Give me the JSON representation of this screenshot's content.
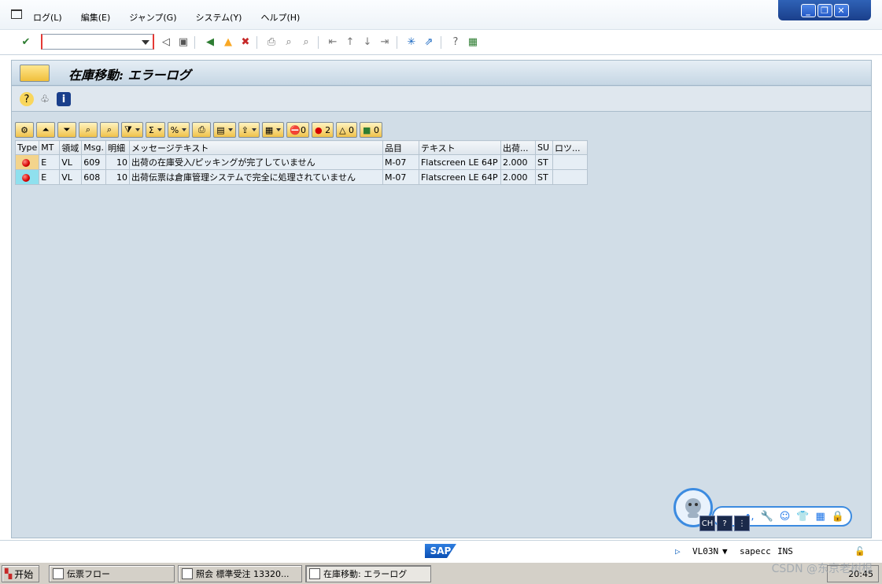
{
  "menubar": {
    "items": [
      "ログ(L)",
      "編集(E)",
      "ジャンプ(G)",
      "システム(Y)",
      "ヘルプ(H)"
    ]
  },
  "window_controls": [
    "minimize",
    "restore",
    "close"
  ],
  "command_field": {
    "value": ""
  },
  "screen": {
    "title": "在庫移動: エラーログ"
  },
  "grid": {
    "columns": [
      "Type",
      "MT",
      "領域",
      "Msg.",
      "明細",
      "メッセージテキスト",
      "品目",
      "テキスト",
      "出荷...",
      "SU",
      "ロツ..."
    ],
    "rows": [
      {
        "type": "error",
        "mt": "E",
        "area": "VL",
        "msg": "609",
        "item": "10",
        "text": "出荷の在庫受入/ピッキングが完了していません",
        "material": "M-07",
        "mtext": "Flatscreen LE 64P",
        "qty": "2.000",
        "su": "ST",
        "lot": ""
      },
      {
        "type": "error",
        "mt": "E",
        "area": "VL",
        "msg": "608",
        "item": "10",
        "text": "出荷伝票は倉庫管理システムで完全に処理されていません",
        "material": "M-07",
        "mtext": "Flatscreen LE 64P",
        "qty": "2.000",
        "su": "ST",
        "lot": ""
      }
    ]
  },
  "counters": {
    "stop": "0",
    "error": "2",
    "warning": "0",
    "ok": "0"
  },
  "status": {
    "transaction": "VL03N",
    "system": "sapecc",
    "mode": "INS",
    "logo": "SAP"
  },
  "taskbar": {
    "start": "开始",
    "tasks": [
      "伝票フロー",
      "照会 標準受注 13320...",
      "在庫移動: エラーログ"
    ],
    "clock": "20:45"
  },
  "ime": {
    "lang": "CH"
  },
  "watermark": "CSDN @东京老树根"
}
